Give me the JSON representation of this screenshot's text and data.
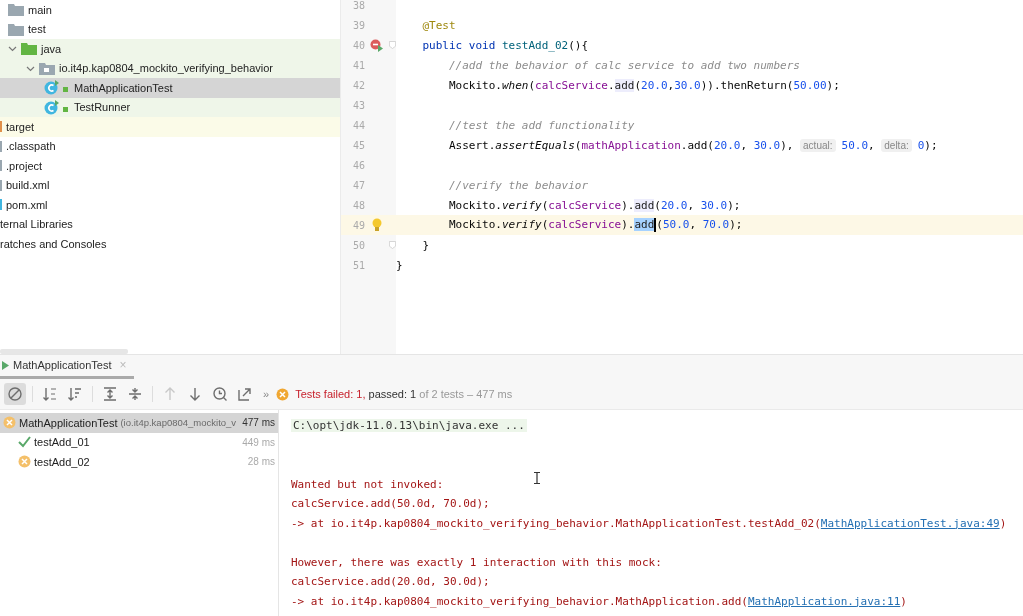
{
  "project_tree": {
    "items": [
      {
        "label": "main",
        "kind": "folder",
        "test_source": false,
        "excluded": false,
        "selected": false
      },
      {
        "label": "test",
        "kind": "folder",
        "test_source": false,
        "excluded": false,
        "selected": false
      },
      {
        "label": "java",
        "kind": "test-root",
        "test_source": true,
        "excluded": false,
        "selected": false,
        "expanded": true,
        "children": [
          {
            "label": "io.it4p.kap0804_mockito_verifying_behavior",
            "kind": "package",
            "test_source": true,
            "excluded": false,
            "selected": false,
            "expanded": true,
            "children": [
              {
                "label": "MathApplicationTest",
                "kind": "test-class",
                "test_source": true,
                "excluded": false,
                "selected": true
              },
              {
                "label": "TestRunner",
                "kind": "test-class",
                "test_source": true,
                "excluded": false,
                "selected": false
              }
            ]
          }
        ]
      },
      {
        "label": "target",
        "kind": "cut-excluded",
        "test_source": false,
        "excluded": true,
        "selected": false
      },
      {
        "label": ".classpath",
        "kind": "cut-file",
        "test_source": false,
        "excluded": false,
        "selected": false
      },
      {
        "label": ".project",
        "kind": "cut-file",
        "test_source": false,
        "excluded": false,
        "selected": false
      },
      {
        "label": "build.xml",
        "kind": "cut-file",
        "test_source": false,
        "excluded": false,
        "selected": false
      },
      {
        "label": "pom.xml",
        "kind": "cut-maven",
        "test_source": false,
        "excluded": false,
        "selected": false
      },
      {
        "label": "ternal Libraries",
        "kind": "cut-none",
        "test_source": false,
        "excluded": false,
        "selected": false
      },
      {
        "label": "ratches and Consoles",
        "kind": "cut-none",
        "test_source": false,
        "excluded": false,
        "selected": false
      }
    ]
  },
  "editor": {
    "lines": [
      {
        "n": "38",
        "current": false
      },
      {
        "n": "39",
        "current": false,
        "tokens": [
          {
            "kind": "ann",
            "t": "    @Test"
          }
        ]
      },
      {
        "n": "40",
        "current": false,
        "failed_run": true,
        "fold": true,
        "tokens": [
          {
            "kind": "kw",
            "t": "    public void "
          },
          {
            "kind": "decl",
            "t": "testAdd_02"
          },
          {
            "kind": "plain",
            "t": "(){"
          }
        ]
      },
      {
        "n": "41",
        "current": false,
        "tokens": [
          {
            "kind": "comment",
            "t": "        //add the behavior of calc service to add two numbers"
          }
        ]
      },
      {
        "n": "42",
        "current": false,
        "tokens": [
          {
            "kind": "plain",
            "t": "        Mockito."
          },
          {
            "kind": "static",
            "t": "when"
          },
          {
            "kind": "plain",
            "t": "("
          },
          {
            "kind": "field",
            "t": "calcService"
          },
          {
            "kind": "plain",
            "t": "."
          },
          {
            "kind": "usage",
            "t": "add"
          },
          {
            "kind": "plain",
            "t": "("
          },
          {
            "kind": "num",
            "t": "20.0"
          },
          {
            "kind": "plain",
            "t": ","
          },
          {
            "kind": "num",
            "t": "30.0"
          },
          {
            "kind": "plain",
            "t": ")).thenReturn("
          },
          {
            "kind": "num",
            "t": "50.00"
          },
          {
            "kind": "plain",
            "t": ");"
          }
        ]
      },
      {
        "n": "43",
        "current": false
      },
      {
        "n": "44",
        "current": false,
        "tokens": [
          {
            "kind": "comment",
            "t": "        //test the add functionality"
          }
        ]
      },
      {
        "n": "45",
        "current": false,
        "tokens": [
          {
            "kind": "plain",
            "t": "        Assert."
          },
          {
            "kind": "static",
            "t": "assertEquals"
          },
          {
            "kind": "plain",
            "t": "("
          },
          {
            "kind": "field",
            "t": "mathApplication"
          },
          {
            "kind": "plain",
            "t": ".add("
          },
          {
            "kind": "num",
            "t": "20.0"
          },
          {
            "kind": "plain",
            "t": ", "
          },
          {
            "kind": "num",
            "t": "30.0"
          },
          {
            "kind": "plain",
            "t": "), "
          },
          {
            "kind": "hint",
            "t": "actual:"
          },
          {
            "kind": "num",
            "t": "50.0"
          },
          {
            "kind": "plain",
            "t": ", "
          },
          {
            "kind": "hint",
            "t": "delta:"
          },
          {
            "kind": "num",
            "t": "0"
          },
          {
            "kind": "plain",
            "t": ");"
          }
        ]
      },
      {
        "n": "46",
        "current": false
      },
      {
        "n": "47",
        "current": false,
        "tokens": [
          {
            "kind": "comment",
            "t": "        //verify the behavior"
          }
        ]
      },
      {
        "n": "48",
        "current": false,
        "tokens": [
          {
            "kind": "plain",
            "t": "        Mockito."
          },
          {
            "kind": "static",
            "t": "verify"
          },
          {
            "kind": "plain",
            "t": "("
          },
          {
            "kind": "field",
            "t": "calcService"
          },
          {
            "kind": "plain",
            "t": ")."
          },
          {
            "kind": "usage",
            "t": "add"
          },
          {
            "kind": "plain",
            "t": "("
          },
          {
            "kind": "num",
            "t": "20.0"
          },
          {
            "kind": "plain",
            "t": ", "
          },
          {
            "kind": "num",
            "t": "30.0"
          },
          {
            "kind": "plain",
            "t": ");"
          }
        ]
      },
      {
        "n": "49",
        "current": true,
        "intention": true,
        "tokens": [
          {
            "kind": "plain",
            "t": "        Mockito."
          },
          {
            "kind": "static",
            "t": "verify"
          },
          {
            "kind": "plain",
            "t": "("
          },
          {
            "kind": "field",
            "t": "calcService"
          },
          {
            "kind": "plain",
            "t": ")."
          },
          {
            "kind": "selected",
            "t": "add",
            "caret": true
          },
          {
            "kind": "plain",
            "t": "("
          },
          {
            "kind": "num",
            "t": "50.0"
          },
          {
            "kind": "plain",
            "t": ", "
          },
          {
            "kind": "num",
            "t": "70.0"
          },
          {
            "kind": "plain",
            "t": ");"
          }
        ]
      },
      {
        "n": "50",
        "current": false,
        "fold": true,
        "tokens": [
          {
            "kind": "plain",
            "t": "    }"
          }
        ]
      },
      {
        "n": "51",
        "current": false,
        "tokens": [
          {
            "kind": "plain",
            "t": "}"
          }
        ]
      }
    ]
  },
  "run_panel": {
    "tab": {
      "label": "MathApplicationTest",
      "close": "×",
      "selected": true
    },
    "toolbar": [
      {
        "kind": "stop",
        "selected": true,
        "disabled": false
      },
      {
        "kind": "sort-alpha",
        "selected": false,
        "disabled": false
      },
      {
        "kind": "sort-duration",
        "selected": false,
        "disabled": false
      },
      {
        "kind": "expand",
        "selected": false,
        "disabled": false
      },
      {
        "kind": "collapse",
        "selected": false,
        "disabled": false
      },
      {
        "kind": "up",
        "selected": false,
        "disabled": true
      },
      {
        "kind": "down",
        "selected": false,
        "disabled": false
      },
      {
        "kind": "history",
        "selected": false,
        "disabled": false
      },
      {
        "kind": "export",
        "selected": false,
        "disabled": false
      }
    ],
    "more": "»",
    "status": {
      "failed": "Tests failed: 1,",
      "passed": "passed: 1",
      "summary": "of 2 tests – 477 ms"
    },
    "tests": [
      {
        "name": "MathApplicationTest",
        "package": "(io.it4p.kap0804_mockito_v",
        "duration": "477 ms",
        "kind": "failed",
        "selected": true,
        "children": [
          {
            "name": "testAdd_01",
            "duration": "449 ms",
            "kind": "passed",
            "selected": false
          },
          {
            "name": "testAdd_02",
            "duration": "28 ms",
            "kind": "failed",
            "selected": false
          }
        ]
      }
    ],
    "console": [
      {
        "kind": "command",
        "text": "C:\\opt\\jdk-11.0.13\\bin\\java.exe ..."
      },
      {
        "kind": "blank"
      },
      {
        "kind": "blank"
      },
      {
        "kind": "error",
        "text": "Wanted but not invoked:"
      },
      {
        "kind": "error",
        "text": "calcService.add(50.0d, 70.0d);"
      },
      {
        "kind": "error",
        "text": "-> at io.it4p.kap0804_mockito_verifying_behavior.MathApplicationTest.testAdd_02(",
        "link": "MathApplicationTest.java:49",
        "after": ")"
      },
      {
        "kind": "blank"
      },
      {
        "kind": "error",
        "text": "However, there was exactly 1 interaction with this mock:"
      },
      {
        "kind": "error",
        "text": "calcService.add(20.0d, 30.0d);"
      },
      {
        "kind": "error",
        "text": "-> at io.it4p.kap0804_mockito_verifying_behavior.MathApplication.add(",
        "link": "MathApplication.java:11",
        "after": ")"
      }
    ]
  }
}
